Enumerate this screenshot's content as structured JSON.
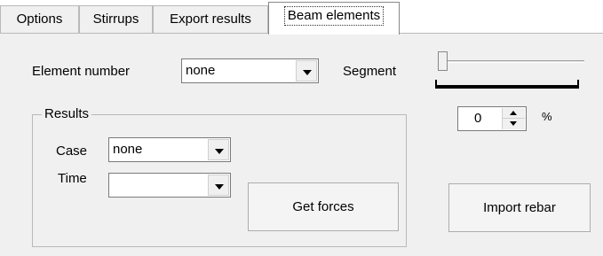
{
  "tabs": [
    {
      "label": "Options"
    },
    {
      "label": "Stirrups"
    },
    {
      "label": "Export results"
    },
    {
      "label": "Beam elements"
    }
  ],
  "active_tab": "Beam elements",
  "element": {
    "label": "Element number",
    "value": "none"
  },
  "segment": {
    "label": "Segment",
    "slider_level": 0,
    "percent_value": "0",
    "percent_unit": "%"
  },
  "results": {
    "title": "Results",
    "case_label": "Case",
    "case_value": "none",
    "time_label": "Time",
    "time_value": ""
  },
  "buttons": {
    "get_forces": "Get forces",
    "import_rebar": "Import rebar"
  }
}
